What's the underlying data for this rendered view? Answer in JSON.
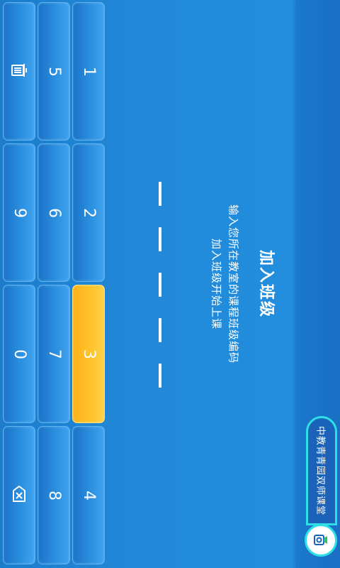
{
  "app": {
    "brand_badge": "中教青青园双师课堂",
    "logo_icon": "camera-speech-logo-icon"
  },
  "join": {
    "title": "加入班级",
    "instruction_line1": "输入您所在教室的课程班级编码",
    "instruction_line2": "加入班级开始上课",
    "code_slots": [
      "",
      "",
      "",
      "",
      ""
    ]
  },
  "keypad": {
    "keys": {
      "k1": "1",
      "k2": "2",
      "k3": "3",
      "k4": "4",
      "k5": "5",
      "k6": "6",
      "k7": "7",
      "k8": "8",
      "k9": "9",
      "k0": "0"
    },
    "active_key": "3",
    "clear_icon": "trash-icon",
    "backspace_icon": "backspace-icon"
  },
  "colors": {
    "background": "#1f7fcf",
    "key_blue": "#2b8fe0",
    "key_active": "#ffc42d",
    "badge_border": "#2ee0e6"
  }
}
